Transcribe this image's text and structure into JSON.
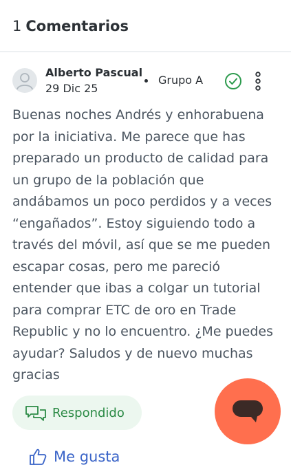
{
  "comments_header": {
    "count": "1",
    "label": "Comentarios"
  },
  "comment": {
    "author": "Alberto Pascual",
    "date": "29 Dic 25",
    "group": "Grupo A",
    "text": "Buenas noches Andrés y enhorabuena por la iniciativa. Me parece que has preparado un producto de calidad para un grupo de la población que andábamos un poco perdidos y a veces “engañados”. Estoy siguiendo todo a través del móvil, así que se me pueden escapar cosas, pero me pareció entender que ibas a colgar un tutorial para comprar ETC de oro en Trade Republic y no lo encuentro. ¿Me puedes ayudar? Saludos y de nuevo muchas gracias",
    "status_label": "Respondido",
    "like_label": "Me gusta"
  },
  "icons": {
    "avatar": "user-placeholder-icon",
    "verified": "check-circle-icon",
    "menu": "kebab-menu-icon",
    "responded": "chat-bubbles-icon",
    "like": "thumbs-up-icon",
    "fab": "chat-icon"
  },
  "colors": {
    "accent_green": "#2b8a45",
    "responded_bg": "#ecf7ef",
    "link_blue": "#3a64c8",
    "fab_orange": "#ff6f4e"
  }
}
